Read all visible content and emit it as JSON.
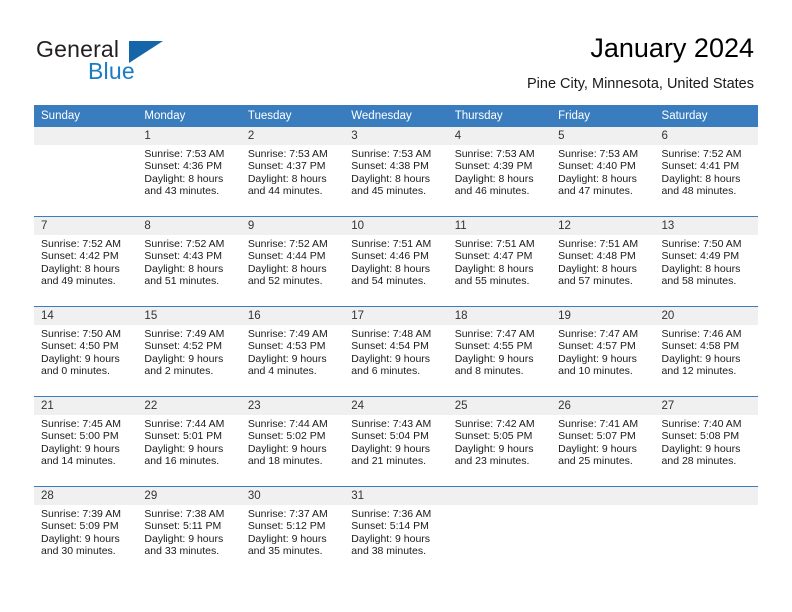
{
  "brand": {
    "name_part1": "General",
    "name_part2": "Blue",
    "accent_color": "#1a7dc4",
    "triangle_color": "#1565a8"
  },
  "header": {
    "title": "January 2024",
    "location": "Pine City, Minnesota, United States"
  },
  "calendar": {
    "header_bg": "#3a7dbf",
    "daynum_bg": "#f0f0f0",
    "weekdays": [
      "Sunday",
      "Monday",
      "Tuesday",
      "Wednesday",
      "Thursday",
      "Friday",
      "Saturday"
    ],
    "weeks": [
      [
        {
          "day": "",
          "sunrise": "",
          "sunset": "",
          "daylight1": "",
          "daylight2": ""
        },
        {
          "day": "1",
          "sunrise": "Sunrise: 7:53 AM",
          "sunset": "Sunset: 4:36 PM",
          "daylight1": "Daylight: 8 hours",
          "daylight2": "and 43 minutes."
        },
        {
          "day": "2",
          "sunrise": "Sunrise: 7:53 AM",
          "sunset": "Sunset: 4:37 PM",
          "daylight1": "Daylight: 8 hours",
          "daylight2": "and 44 minutes."
        },
        {
          "day": "3",
          "sunrise": "Sunrise: 7:53 AM",
          "sunset": "Sunset: 4:38 PM",
          "daylight1": "Daylight: 8 hours",
          "daylight2": "and 45 minutes."
        },
        {
          "day": "4",
          "sunrise": "Sunrise: 7:53 AM",
          "sunset": "Sunset: 4:39 PM",
          "daylight1": "Daylight: 8 hours",
          "daylight2": "and 46 minutes."
        },
        {
          "day": "5",
          "sunrise": "Sunrise: 7:53 AM",
          "sunset": "Sunset: 4:40 PM",
          "daylight1": "Daylight: 8 hours",
          "daylight2": "and 47 minutes."
        },
        {
          "day": "6",
          "sunrise": "Sunrise: 7:52 AM",
          "sunset": "Sunset: 4:41 PM",
          "daylight1": "Daylight: 8 hours",
          "daylight2": "and 48 minutes."
        }
      ],
      [
        {
          "day": "7",
          "sunrise": "Sunrise: 7:52 AM",
          "sunset": "Sunset: 4:42 PM",
          "daylight1": "Daylight: 8 hours",
          "daylight2": "and 49 minutes."
        },
        {
          "day": "8",
          "sunrise": "Sunrise: 7:52 AM",
          "sunset": "Sunset: 4:43 PM",
          "daylight1": "Daylight: 8 hours",
          "daylight2": "and 51 minutes."
        },
        {
          "day": "9",
          "sunrise": "Sunrise: 7:52 AM",
          "sunset": "Sunset: 4:44 PM",
          "daylight1": "Daylight: 8 hours",
          "daylight2": "and 52 minutes."
        },
        {
          "day": "10",
          "sunrise": "Sunrise: 7:51 AM",
          "sunset": "Sunset: 4:46 PM",
          "daylight1": "Daylight: 8 hours",
          "daylight2": "and 54 minutes."
        },
        {
          "day": "11",
          "sunrise": "Sunrise: 7:51 AM",
          "sunset": "Sunset: 4:47 PM",
          "daylight1": "Daylight: 8 hours",
          "daylight2": "and 55 minutes."
        },
        {
          "day": "12",
          "sunrise": "Sunrise: 7:51 AM",
          "sunset": "Sunset: 4:48 PM",
          "daylight1": "Daylight: 8 hours",
          "daylight2": "and 57 minutes."
        },
        {
          "day": "13",
          "sunrise": "Sunrise: 7:50 AM",
          "sunset": "Sunset: 4:49 PM",
          "daylight1": "Daylight: 8 hours",
          "daylight2": "and 58 minutes."
        }
      ],
      [
        {
          "day": "14",
          "sunrise": "Sunrise: 7:50 AM",
          "sunset": "Sunset: 4:50 PM",
          "daylight1": "Daylight: 9 hours",
          "daylight2": "and 0 minutes."
        },
        {
          "day": "15",
          "sunrise": "Sunrise: 7:49 AM",
          "sunset": "Sunset: 4:52 PM",
          "daylight1": "Daylight: 9 hours",
          "daylight2": "and 2 minutes."
        },
        {
          "day": "16",
          "sunrise": "Sunrise: 7:49 AM",
          "sunset": "Sunset: 4:53 PM",
          "daylight1": "Daylight: 9 hours",
          "daylight2": "and 4 minutes."
        },
        {
          "day": "17",
          "sunrise": "Sunrise: 7:48 AM",
          "sunset": "Sunset: 4:54 PM",
          "daylight1": "Daylight: 9 hours",
          "daylight2": "and 6 minutes."
        },
        {
          "day": "18",
          "sunrise": "Sunrise: 7:47 AM",
          "sunset": "Sunset: 4:55 PM",
          "daylight1": "Daylight: 9 hours",
          "daylight2": "and 8 minutes."
        },
        {
          "day": "19",
          "sunrise": "Sunrise: 7:47 AM",
          "sunset": "Sunset: 4:57 PM",
          "daylight1": "Daylight: 9 hours",
          "daylight2": "and 10 minutes."
        },
        {
          "day": "20",
          "sunrise": "Sunrise: 7:46 AM",
          "sunset": "Sunset: 4:58 PM",
          "daylight1": "Daylight: 9 hours",
          "daylight2": "and 12 minutes."
        }
      ],
      [
        {
          "day": "21",
          "sunrise": "Sunrise: 7:45 AM",
          "sunset": "Sunset: 5:00 PM",
          "daylight1": "Daylight: 9 hours",
          "daylight2": "and 14 minutes."
        },
        {
          "day": "22",
          "sunrise": "Sunrise: 7:44 AM",
          "sunset": "Sunset: 5:01 PM",
          "daylight1": "Daylight: 9 hours",
          "daylight2": "and 16 minutes."
        },
        {
          "day": "23",
          "sunrise": "Sunrise: 7:44 AM",
          "sunset": "Sunset: 5:02 PM",
          "daylight1": "Daylight: 9 hours",
          "daylight2": "and 18 minutes."
        },
        {
          "day": "24",
          "sunrise": "Sunrise: 7:43 AM",
          "sunset": "Sunset: 5:04 PM",
          "daylight1": "Daylight: 9 hours",
          "daylight2": "and 21 minutes."
        },
        {
          "day": "25",
          "sunrise": "Sunrise: 7:42 AM",
          "sunset": "Sunset: 5:05 PM",
          "daylight1": "Daylight: 9 hours",
          "daylight2": "and 23 minutes."
        },
        {
          "day": "26",
          "sunrise": "Sunrise: 7:41 AM",
          "sunset": "Sunset: 5:07 PM",
          "daylight1": "Daylight: 9 hours",
          "daylight2": "and 25 minutes."
        },
        {
          "day": "27",
          "sunrise": "Sunrise: 7:40 AM",
          "sunset": "Sunset: 5:08 PM",
          "daylight1": "Daylight: 9 hours",
          "daylight2": "and 28 minutes."
        }
      ],
      [
        {
          "day": "28",
          "sunrise": "Sunrise: 7:39 AM",
          "sunset": "Sunset: 5:09 PM",
          "daylight1": "Daylight: 9 hours",
          "daylight2": "and 30 minutes."
        },
        {
          "day": "29",
          "sunrise": "Sunrise: 7:38 AM",
          "sunset": "Sunset: 5:11 PM",
          "daylight1": "Daylight: 9 hours",
          "daylight2": "and 33 minutes."
        },
        {
          "day": "30",
          "sunrise": "Sunrise: 7:37 AM",
          "sunset": "Sunset: 5:12 PM",
          "daylight1": "Daylight: 9 hours",
          "daylight2": "and 35 minutes."
        },
        {
          "day": "31",
          "sunrise": "Sunrise: 7:36 AM",
          "sunset": "Sunset: 5:14 PM",
          "daylight1": "Daylight: 9 hours",
          "daylight2": "and 38 minutes."
        },
        {
          "day": "",
          "sunrise": "",
          "sunset": "",
          "daylight1": "",
          "daylight2": ""
        },
        {
          "day": "",
          "sunrise": "",
          "sunset": "",
          "daylight1": "",
          "daylight2": ""
        },
        {
          "day": "",
          "sunrise": "",
          "sunset": "",
          "daylight1": "",
          "daylight2": ""
        }
      ]
    ]
  }
}
